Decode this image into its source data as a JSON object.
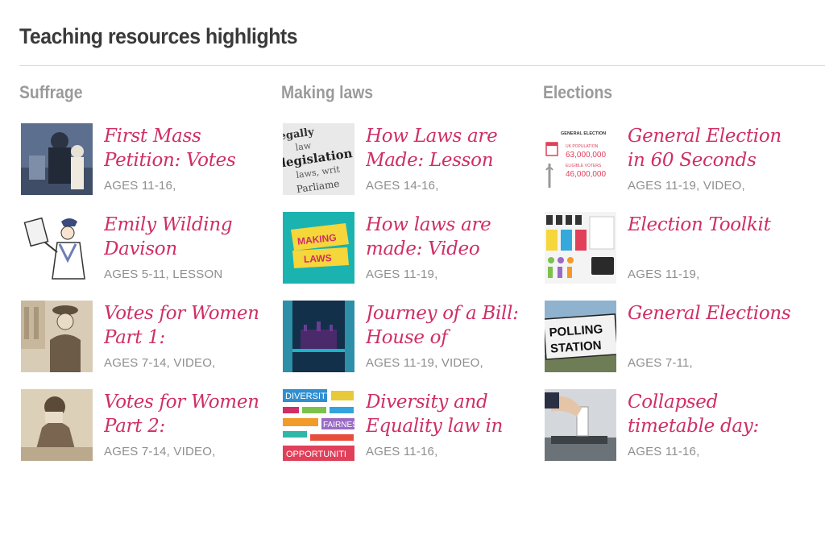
{
  "page": {
    "heading": "Teaching resources highlights",
    "accent_color": "#cf2e66"
  },
  "columns": [
    {
      "title": "Suffrage",
      "items": [
        {
          "title": "First Mass Petition: Votes",
          "meta": "AGES 11-16,"
        },
        {
          "title": "Emily Wilding Davison",
          "meta": "AGES 5-11, LESSON"
        },
        {
          "title": "Votes for Women Part 1:",
          "meta": "AGES 7-14, VIDEO,"
        },
        {
          "title": "Votes for Women Part 2:",
          "meta": "AGES 7-14, VIDEO,"
        }
      ]
    },
    {
      "title": "Making laws",
      "items": [
        {
          "title": "How Laws are Made: Lesson",
          "meta": "AGES 14-16,"
        },
        {
          "title": "How laws are made: Video",
          "meta": "AGES 11-19,"
        },
        {
          "title": "Journey of a Bill: House of",
          "meta": "AGES 11-19, VIDEO,"
        },
        {
          "title": "Diversity and Equality law in",
          "meta": "AGES 11-16,"
        }
      ]
    },
    {
      "title": "Elections",
      "items": [
        {
          "title": "General Election in 60 Seconds",
          "meta": "AGES 11-19, VIDEO,"
        },
        {
          "title": "Election Toolkit",
          "meta": "AGES 11-19,"
        },
        {
          "title": "General Elections",
          "meta": "AGES 7-11,"
        },
        {
          "title": "Collapsed timetable day:",
          "meta": "AGES 11-16,"
        }
      ]
    }
  ],
  "thumb_text": {
    "laws_card": [
      "egally",
      "law",
      "legislation",
      "laws, writ",
      "Parliame"
    ],
    "making_laws": [
      "MAKING",
      "LAWS"
    ],
    "general_election": [
      "GENERAL ELECTION",
      "UK POPULATION",
      "63,000,000",
      "ELIGIBLE VOTERS",
      "46,000,000"
    ],
    "polling_station": [
      "POLLING",
      "STATION"
    ],
    "diversity": [
      "DIVERSITY",
      "FAIRNES",
      "OPPORTUNITI"
    ]
  }
}
